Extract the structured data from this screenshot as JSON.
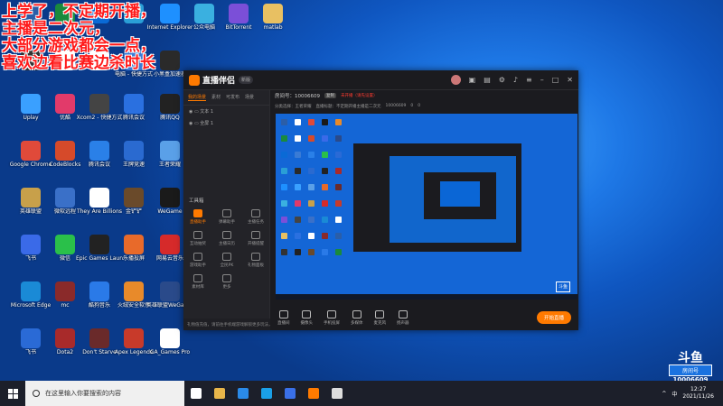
{
  "overlay_text": [
    "上学了，不定期开播，",
    "主播是二次元，",
    "大部分游戏都会一点，",
    "喜欢边看比赛边杀时长"
  ],
  "desktop": {
    "icons": [
      {
        "label": "",
        "color": "#2b5ea8"
      },
      {
        "label": "",
        "color": "#1a8a3c"
      },
      {
        "label": "",
        "color": "#0a6ad6"
      },
      {
        "label": "",
        "color": "#2a9fd6"
      },
      {
        "label": "Internet Explorer",
        "color": "#1e90ff"
      },
      {
        "label": "公众电脑",
        "color": "#3ab0e0"
      },
      {
        "label": "BitTorrent",
        "color": "#7b4fd8"
      },
      {
        "label": "matlab",
        "color": "#e8c062"
      },
      {
        "label": "",
        "color": "#333333"
      },
      {
        "label": "",
        "color": "#ffffff"
      },
      {
        "label": "",
        "color": "#ffffff"
      },
      {
        "label": "电脑 - 快捷方式",
        "color": "#3a7bd5"
      },
      {
        "label": "小黑盒加速器",
        "color": "#2a2a2a"
      },
      {
        "label": "Uplay",
        "color": "#3aa0ff"
      },
      {
        "label": "优酷",
        "color": "#e23a6a"
      },
      {
        "label": "Xcom2 - 快捷方式",
        "color": "#444444"
      },
      {
        "label": "腾讯会议",
        "color": "#2a70e0"
      },
      {
        "label": "腾讯QQ",
        "color": "#222222"
      },
      {
        "label": "Google Chrome",
        "color": "#e04a3a"
      },
      {
        "label": "CodeBlocks",
        "color": "#d64a2a"
      },
      {
        "label": "腾讯会议",
        "color": "#2a80e8"
      },
      {
        "label": "王牌竞速",
        "color": "#2a6ad0"
      },
      {
        "label": "王者荣耀",
        "color": "#5aa0e8"
      },
      {
        "label": "英雄联盟",
        "color": "#c8a04a"
      },
      {
        "label": "微软远程",
        "color": "#3a70c8"
      },
      {
        "label": "They Are Billions",
        "color": "#ffffff"
      },
      {
        "label": "金铲铲",
        "color": "#6a4a2a"
      },
      {
        "label": "WeGame",
        "color": "#1a1a1a"
      },
      {
        "label": "飞书",
        "color": "#3a6ae8"
      },
      {
        "label": "微信",
        "color": "#2ac04a"
      },
      {
        "label": "Epic Games Launcher",
        "color": "#222222"
      },
      {
        "label": "乐播投屏",
        "color": "#e86a2a"
      },
      {
        "label": "网易云音乐",
        "color": "#d62a2a"
      },
      {
        "label": "Microsoft Edge",
        "color": "#1a8ad6"
      },
      {
        "label": "mc",
        "color": "#8a2a2a"
      },
      {
        "label": "酷狗音乐",
        "color": "#2a7ae8"
      },
      {
        "label": "火绒安全软件",
        "color": "#e88a2a"
      },
      {
        "label": "英雄联盟WeGame版",
        "color": "#2a4a8a"
      },
      {
        "label": "飞书",
        "color": "#2a6ad6"
      },
      {
        "label": "Dota2",
        "color": "#a82a2a"
      },
      {
        "label": "Don't Starve",
        "color": "#6a2a2a"
      },
      {
        "label": "Apex Legends",
        "color": "#c83a2a"
      },
      {
        "label": "GA_Games Pro",
        "color": "#ffffff"
      }
    ]
  },
  "app": {
    "title": "直播伴侣",
    "version": "新版",
    "left_tabs": [
      "我的场景",
      "素材",
      "可发布",
      "场景"
    ],
    "scenes": [
      "文本 1",
      "全屏 1"
    ],
    "toolbox_title": "工具箱",
    "tools": [
      {
        "label": "直播助手",
        "hot": true
      },
      {
        "label": "弹幕助手",
        "hot": false
      },
      {
        "label": "主播任务",
        "hot": false
      },
      {
        "label": "互动抽奖",
        "hot": false
      },
      {
        "label": "主播日历",
        "hot": false
      },
      {
        "label": "开播提醒",
        "hot": false
      },
      {
        "label": "游戏助手",
        "hot": false
      },
      {
        "label": "全民PK",
        "hot": false
      },
      {
        "label": "礼物面板",
        "hot": false
      },
      {
        "label": "素材库",
        "hot": false
      },
      {
        "label": "更多",
        "hot": false
      }
    ],
    "room": {
      "label": "房间号：10006609",
      "tag": "复制",
      "status": "未开播（请先设置）"
    },
    "sub": {
      "category": "分类选择：王者荣耀",
      "title": "直播标题：不定期开播主播是二次元",
      "room_id": "10006609",
      "likes": "0",
      "viewers": "0"
    },
    "controls": [
      "直播间",
      "摄像头",
      "手机投屏",
      "多媒体",
      "麦克风",
      "扬声器"
    ],
    "start_live": "开始直播",
    "bottom_notice": "礼物值充值，请前往手机端游戏解锁更多玩法，感谢支持"
  },
  "taskbar": {
    "search_placeholder": "在这里输入你要搜索的内容",
    "apps": [
      {
        "name": "task-view",
        "color": "#ffffff"
      },
      {
        "name": "file-explorer",
        "color": "#e8b64a"
      },
      {
        "name": "mail",
        "color": "#2a8ae8"
      },
      {
        "name": "edge",
        "color": "#1aa0e8"
      },
      {
        "name": "store",
        "color": "#3a70e8"
      },
      {
        "name": "live-companion",
        "color": "#ff7a00"
      },
      {
        "name": "game",
        "color": "#dddddd"
      }
    ],
    "tray": [
      "^",
      "中"
    ],
    "time": "12:27",
    "date": "2021/11/26"
  },
  "watermark": {
    "logo": "斗鱼",
    "room_label": "房间号",
    "room_number": "10006609"
  }
}
